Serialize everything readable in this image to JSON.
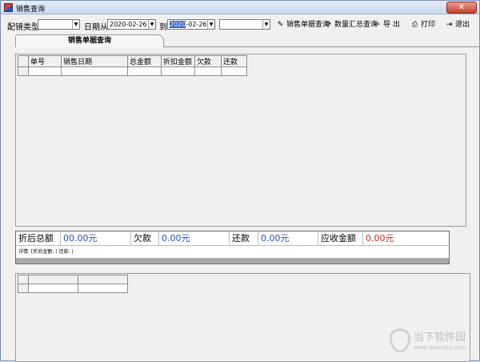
{
  "window": {
    "title": "销售查询",
    "close_label": "✕"
  },
  "toolbar": {
    "type_label": "配镜类型",
    "type_value": "",
    "date_from_label": "日期从",
    "date_from_value": "2020-02-26",
    "date_to_label": "到",
    "date_to_year": "2020",
    "date_to_rest": "-02-26",
    "extra_value": "",
    "buttons": {
      "sales_query": "销售单据查询",
      "qty_summary": "数量汇总查询",
      "export": "导 出",
      "print": "打印",
      "exit": "退出"
    }
  },
  "tabs": [
    {
      "label": "销售单据查询"
    }
  ],
  "sales_table": {
    "columns": [
      "",
      "单号",
      "销售日期",
      "总金额",
      "折扣金额",
      "欠款",
      "还款"
    ]
  },
  "summary": {
    "discount_total_label": "折后总额",
    "discount_total_value": "00.00元",
    "debt_label": "欠款",
    "debt_value": "0.00元",
    "repay_label": "还款",
    "repay_value": "0.00元",
    "receivable_label": "应收金额",
    "receivable_value": "0.00元",
    "detail_text": "详情: [折后金额: (        还款: )"
  },
  "detail_table": {
    "columns": [
      "",
      "",
      ""
    ]
  },
  "watermark": {
    "text": "当下软件园",
    "url": "www.downxia.com"
  },
  "colors": {
    "blue_value": "#1f4fd6",
    "red_value": "#e02020",
    "selection": "#3166c9"
  },
  "icons": {
    "sales_query": "pencil-icon",
    "qty_summary": "refresh-icon",
    "export": "export-icon",
    "print": "printer-icon",
    "exit": "exit-icon"
  }
}
